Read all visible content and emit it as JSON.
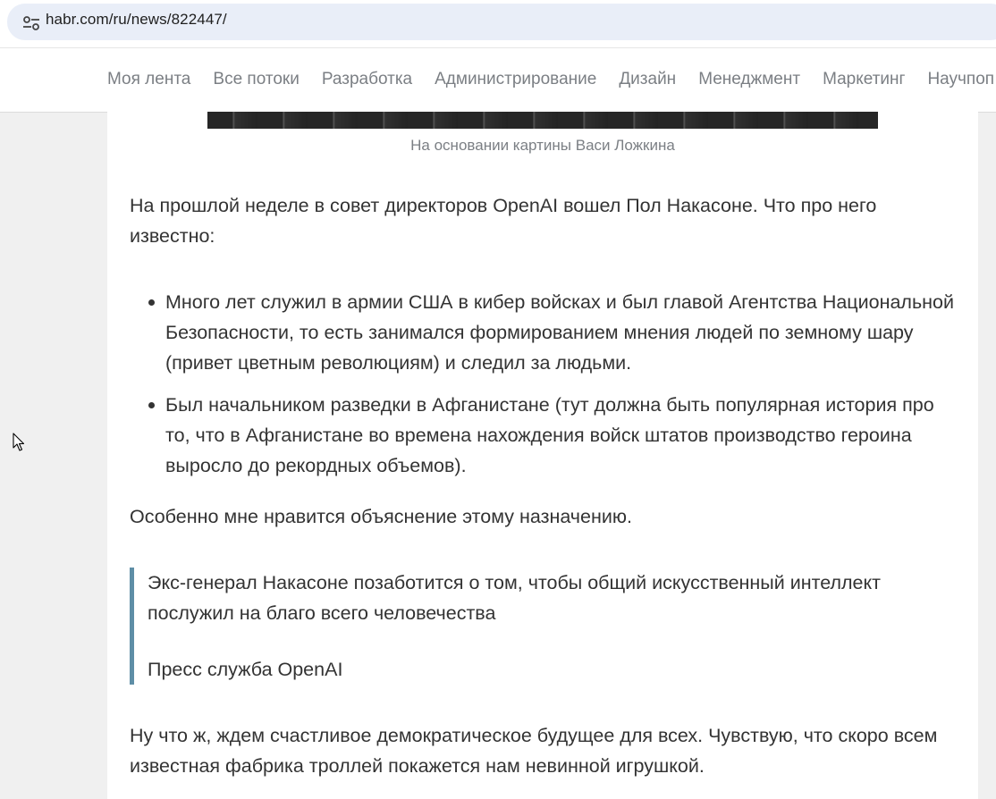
{
  "browser": {
    "url": "habr.com/ru/news/822447/",
    "site_icon": "tune-icon"
  },
  "nav": {
    "items": [
      {
        "label": "Моя лента"
      },
      {
        "label": "Все потоки"
      },
      {
        "label": "Разработка"
      },
      {
        "label": "Администрирование"
      },
      {
        "label": "Дизайн"
      },
      {
        "label": "Менеджмент"
      },
      {
        "label": "Маркетинг"
      },
      {
        "label": "Научпоп"
      }
    ]
  },
  "article": {
    "image_caption": "На основании картины Васи Ложкина",
    "intro": "На прошлой неделе в совет директоров OpenAI вошел Пол Накасоне. Что про него известно:",
    "bullets": [
      "Много лет служил в армии США в кибер войсках и был главой Агентства Национальной Безопасности, то есть занимался формированием мнения людей по земному шару (привет цветным революциям) и следил за людьми.",
      "Был начальником разведки в Афганистане (тут должна быть популярная история про то, что в Афганистане во времена нахождения войск штатов производство героина выросло до рекордных объемов)."
    ],
    "lead_in": "Особенно мне нравится объяснение этому назначению.",
    "quote": {
      "text": "Экс-генерал Накасоне позаботится о том, чтобы общий искусственный интеллект послужил на благо всего человечества",
      "source": "Пресс служба OpenAI"
    },
    "closing": "Ну что ж, ждем счастливое демократическое будущее для всех. Чувствую, что скоро всем известная фабрика троллей покажется нам невинной игрушкой."
  },
  "colors": {
    "nav_text": "#7b7f84",
    "body_text": "#333333",
    "quote_border": "#5e8ea6",
    "page_bg": "#f0f0f0",
    "url_bar_bg": "#e9eef8"
  }
}
